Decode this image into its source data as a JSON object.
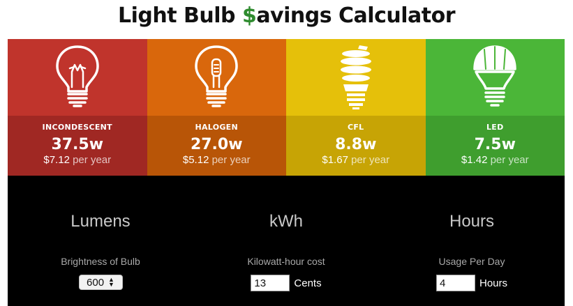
{
  "title": {
    "prefix": "Light Bulb ",
    "dollar": "$",
    "suffix": "avings Calculator"
  },
  "bulbs": [
    {
      "name": "INCONDESCENT",
      "watts": "37.5w",
      "cost": "$7.12",
      "per": "per year",
      "icon": "incandescent-bulb-icon"
    },
    {
      "name": "HALOGEN",
      "watts": "27.0w",
      "cost": "$5.12",
      "per": "per year",
      "icon": "halogen-bulb-icon"
    },
    {
      "name": "CFL",
      "watts": "8.8w",
      "cost": "$1.67",
      "per": "per year",
      "icon": "cfl-bulb-icon"
    },
    {
      "name": "LED",
      "watts": "7.5w",
      "cost": "$1.42",
      "per": "per year",
      "icon": "led-bulb-icon"
    }
  ],
  "colors": {
    "incandescent": "#c0342c",
    "halogen": "#d9670c",
    "cfl": "#e5c00a",
    "led": "#4bb638",
    "dollar": "#2e8b2e"
  },
  "controls": {
    "lumens": {
      "heading": "Lumens",
      "label": "Brightness of Bulb",
      "value": "600"
    },
    "kwh": {
      "heading": "kWh",
      "label": "Kilowatt-hour cost",
      "value": "13",
      "unit": "Cents"
    },
    "hours": {
      "heading": "Hours",
      "label": "Usage Per Day",
      "value": "4",
      "unit": "Hours"
    }
  }
}
